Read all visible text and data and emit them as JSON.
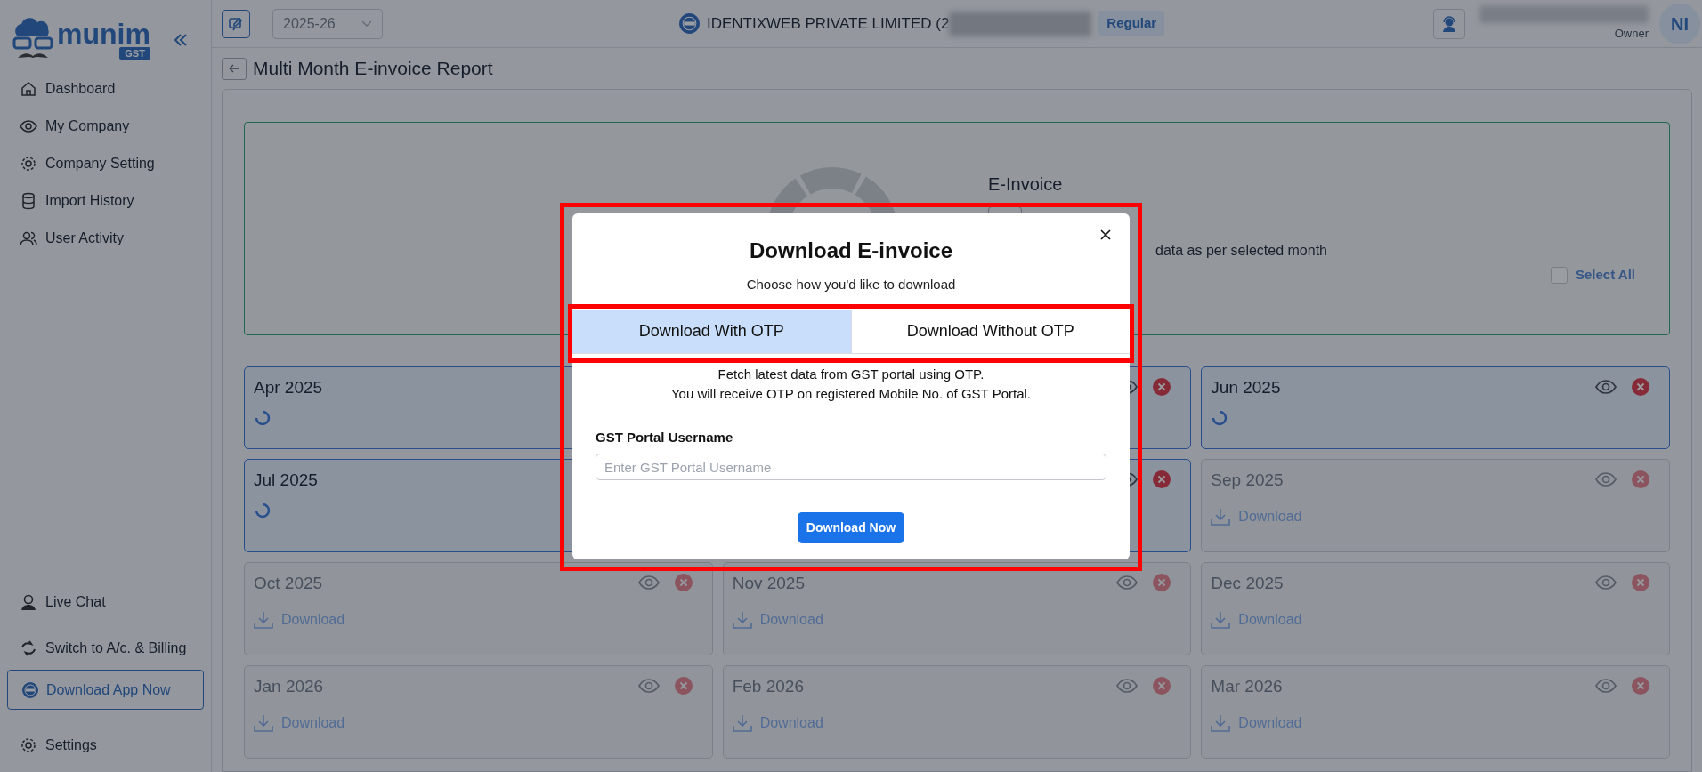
{
  "sidebar": {
    "brand": {
      "name": "munim",
      "tag": "GST"
    },
    "items": [
      {
        "label": "Dashboard"
      },
      {
        "label": "My Company"
      },
      {
        "label": "Company Setting"
      },
      {
        "label": "Import History"
      },
      {
        "label": "User Activity"
      }
    ],
    "bottom_items": [
      {
        "label": "Live Chat",
        "kind": "link"
      },
      {
        "label": "Switch to A/c. & Billing",
        "kind": "link"
      },
      {
        "label": "Download App Now",
        "kind": "cta"
      },
      {
        "label": "Settings",
        "kind": "link"
      }
    ]
  },
  "topbar": {
    "year": "2025-26",
    "company": "IDENTIXWEB PRIVATE LIMITED (2",
    "badge": "Regular",
    "role": "Owner",
    "avatar": "NI"
  },
  "page": {
    "title": "Multi Month E-invoice Report"
  },
  "summary": {
    "heading": "E-Invoice",
    "note": "data as per selected month",
    "select_all": {
      "label": "Select All",
      "checked": false
    }
  },
  "months": [
    {
      "title": "Apr 2025",
      "kind": "loading"
    },
    {
      "kind": "loading"
    },
    {
      "title": "Jun 2025",
      "kind": "loading"
    },
    {
      "title": "Jul 2025",
      "kind": "loading"
    },
    {
      "kind": "loading"
    },
    {
      "title": "Sep 2025",
      "kind": "idle",
      "action": "Download"
    },
    {
      "title": "Oct 2025",
      "kind": "idle",
      "action": "Download"
    },
    {
      "title": "Nov 2025",
      "kind": "idle",
      "action": "Download"
    },
    {
      "title": "Dec 2025",
      "kind": "idle",
      "action": "Download"
    },
    {
      "title": "Jan 2026",
      "kind": "idle",
      "action": "Download"
    },
    {
      "title": "Feb 2026",
      "kind": "idle",
      "action": "Download"
    },
    {
      "title": "Mar 2026",
      "kind": "idle",
      "action": "Download"
    }
  ],
  "dialog": {
    "title": "Download E-invoice",
    "subtitle": "Choose how you'd like to download",
    "tabs": [
      {
        "label": "Download With OTP",
        "selected": true
      },
      {
        "label": "Download Without OTP",
        "selected": false
      }
    ],
    "description": [
      "Fetch latest data from GST portal using OTP.",
      "You will receive OTP on registered Mobile No. of GST Portal."
    ],
    "field": {
      "label": "GST Portal Username",
      "placeholder": "Enter GST Portal Username"
    },
    "submit": "Download Now"
  }
}
